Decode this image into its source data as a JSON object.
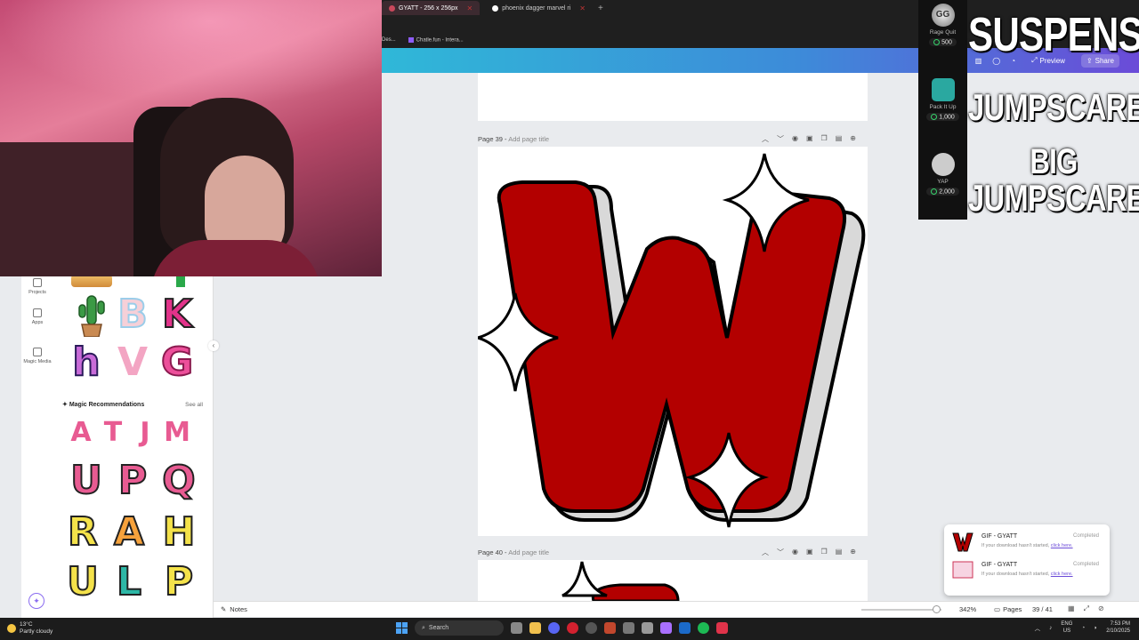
{
  "browser": {
    "tabs": [
      {
        "label": "GYATT - 256 x 256px",
        "active": true
      },
      {
        "label": "phoenix dagger marvel ri",
        "active": false
      }
    ],
    "bookmarks": [
      "Des...",
      "Chatle.fun - Intera..."
    ]
  },
  "header": {
    "preview_label": "Preview",
    "share_label": "Share"
  },
  "pages": [
    {
      "label": "Page 39",
      "sub": "Add page title"
    },
    {
      "label": "Page 40",
      "sub": "Add page title"
    }
  ],
  "sidebar": {
    "rail": [
      {
        "label": "Projects",
        "icon": "folder-icon"
      },
      {
        "label": "Apps",
        "icon": "apps-icon"
      },
      {
        "label": "Magic Media",
        "icon": "magic-media-icon"
      }
    ],
    "letters_top": [
      "B",
      "K",
      "h",
      "V",
      "G"
    ],
    "magic_title": "Magic Recommendations",
    "see_all": "See all",
    "magic_letters": [
      "A",
      "T",
      "J",
      "M"
    ],
    "grid_letters": [
      "U",
      "P",
      "Q",
      "R",
      "A",
      "H",
      "U",
      "L",
      "P"
    ]
  },
  "alerts": [
    {
      "name": "Rage Quit",
      "cost": "500"
    },
    {
      "name": "Pack It Up",
      "cost": "1,000"
    },
    {
      "name": "YAP",
      "cost": "2,000"
    }
  ],
  "overlay_words": [
    "SUSPENSE",
    "JUMPSCARE",
    "BIG",
    "JUMPSCARE"
  ],
  "badge": "GG",
  "downloads": [
    {
      "name": "GIF - GYATT",
      "status": "Completed",
      "note": "If your download hasn't started,",
      "link": "click here."
    },
    {
      "name": "GIF - GYATT",
      "status": "Completed",
      "note": "If your download hasn't started,",
      "link": "click here."
    }
  ],
  "bottombar": {
    "notes_label": "Notes",
    "zoom": "342%",
    "pages_label": "Pages",
    "page_count": "39 / 41"
  },
  "taskbar": {
    "temp": "13°C",
    "weather": "Partly cloudy",
    "search": "Search",
    "lang_1": "ENG",
    "lang_2": "US",
    "time": "7:53 PM",
    "date": "2/10/2025"
  },
  "colors": {
    "letter_red": "#b30000",
    "accent_purple": "#6c4cd8",
    "header_start": "#2fb8d8",
    "header_end": "#6b4bd8"
  }
}
